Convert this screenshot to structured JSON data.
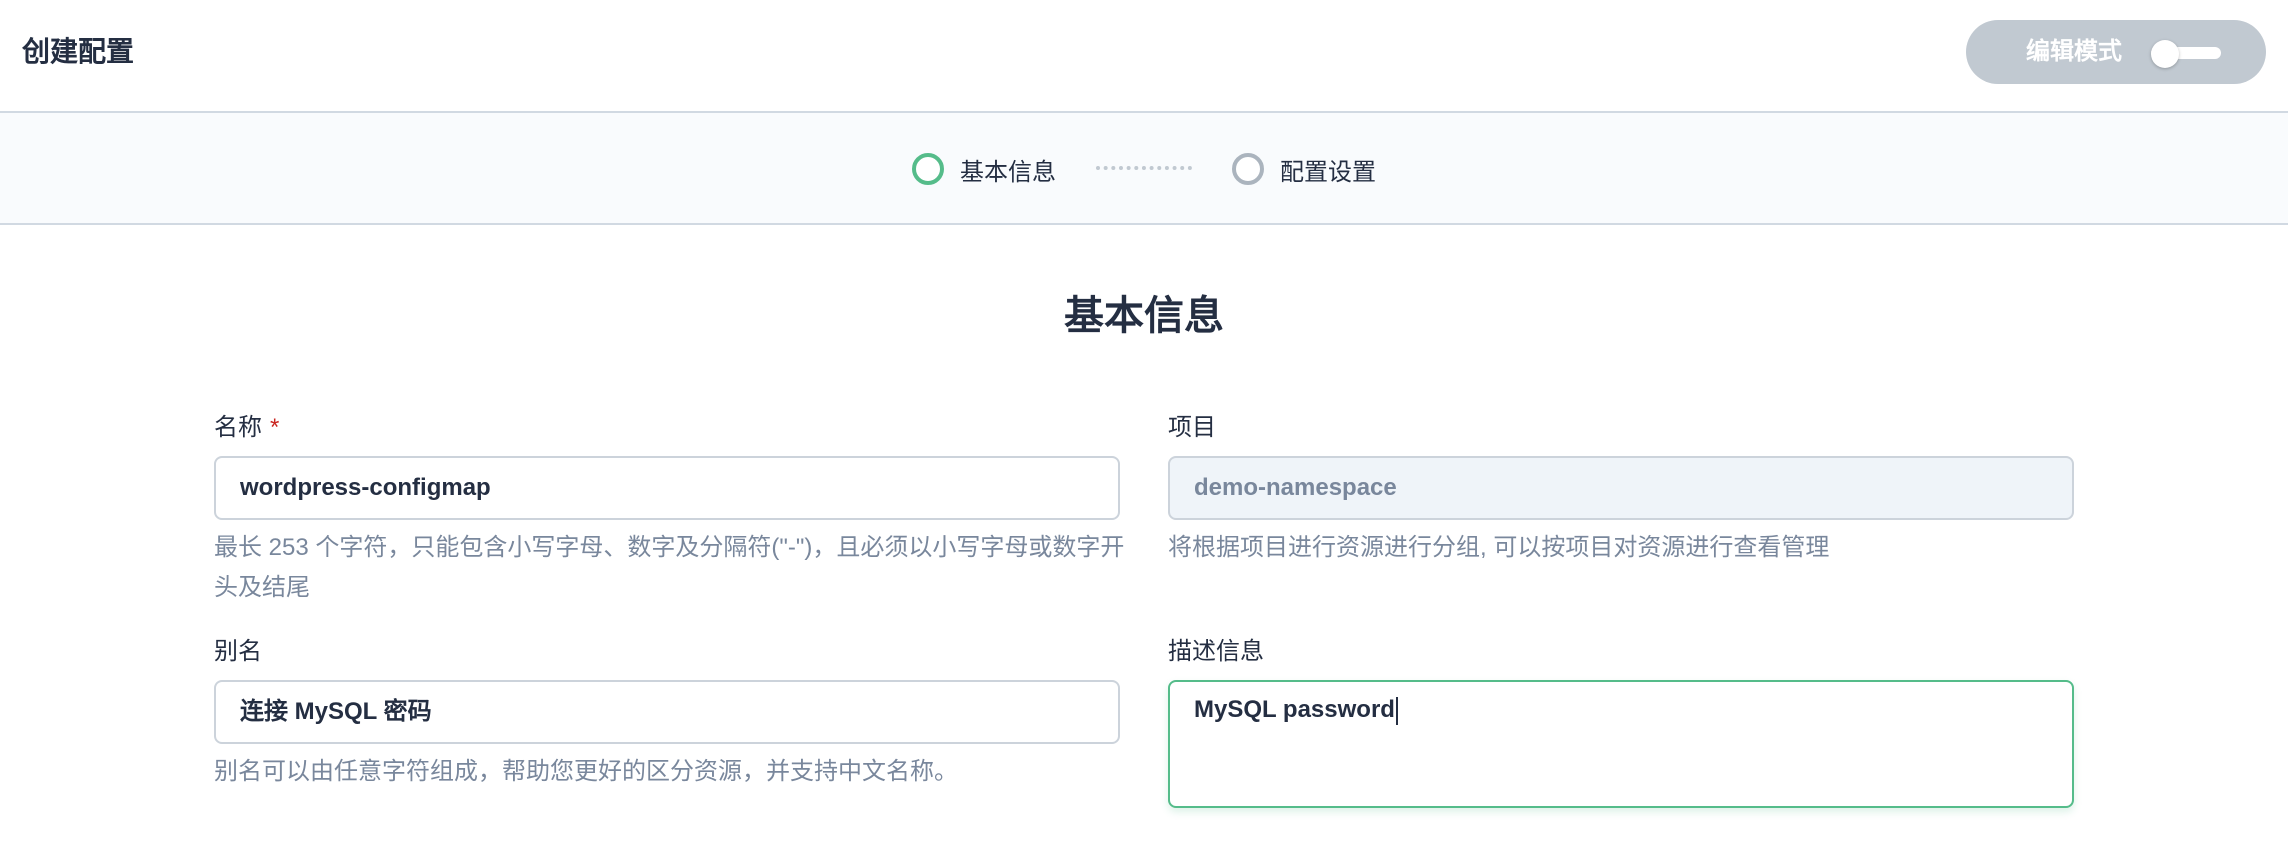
{
  "header": {
    "title": "创建配置",
    "edit_mode_label": "编辑模式"
  },
  "steps": [
    {
      "label": "基本信息",
      "state": "active"
    },
    {
      "label": "配置设置",
      "state": "inactive"
    }
  ],
  "section_title": "基本信息",
  "form": {
    "name": {
      "label": "名称",
      "required_mark": "*",
      "value": "wordpress-configmap",
      "help": "最长 253 个字符，只能包含小写字母、数字及分隔符(\"-\")，且必须以小写字母或数字开头及结尾"
    },
    "project": {
      "label": "项目",
      "value": "demo-namespace",
      "help": "将根据项目进行资源进行分组, 可以按项目对资源进行查看管理"
    },
    "alias": {
      "label": "别名",
      "value": "连接 MySQL 密码",
      "help": "别名可以由任意字符组成，帮助您更好的区分资源，并支持中文名称。"
    },
    "description": {
      "label": "描述信息",
      "value": "MySQL password"
    }
  },
  "colors": {
    "accent_green": "#55bc8a",
    "required_red": "#ca2621",
    "muted_text": "#79879c",
    "toggle_bg": "#c1c9d1"
  }
}
